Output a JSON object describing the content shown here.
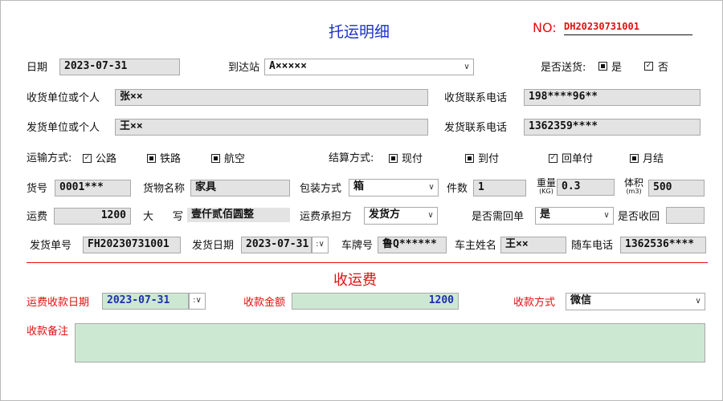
{
  "header": {
    "title": "托运明细",
    "no_label": "NO:",
    "no_value": "DH20230731001"
  },
  "row1": {
    "date_label": "日期",
    "date_value": "2023-07-31",
    "station_label": "到达站",
    "station_value": "A×××××",
    "delivery_label": "是否送货:",
    "delivery_yes": "是",
    "delivery_no": "否"
  },
  "row2": {
    "receiver_label": "收货单位或个人",
    "receiver_value": "张××",
    "receiver_phone_label": "收货联系电话",
    "receiver_phone_value": "198****96**"
  },
  "row3": {
    "sender_label": "发货单位或个人",
    "sender_value": "王××",
    "sender_phone_label": "发货联系电话",
    "sender_phone_value": "1362359****"
  },
  "row4": {
    "transport_label": "运输方式:",
    "transport_road": "公路",
    "transport_rail": "铁路",
    "transport_air": "航空",
    "settle_label": "结算方式:",
    "settle_cash": "现付",
    "settle_cod": "到付",
    "settle_receipt": "回单付",
    "settle_monthly": "月结"
  },
  "row5": {
    "goods_no_label": "货号",
    "goods_no_value": "0001***",
    "goods_name_label": "货物名称",
    "goods_name_value": "家具",
    "pack_label": "包装方式",
    "pack_value": "箱",
    "qty_label": "件数",
    "qty_value": "1",
    "weight_label": "重量",
    "weight_unit": "(KG)",
    "weight_value": "0.3",
    "volume_label": "体积",
    "volume_unit": "(m3)",
    "volume_value": "500"
  },
  "row6": {
    "freight_label": "运费",
    "freight_value": "1200",
    "capital_label_a": "大",
    "capital_label_b": "写",
    "capital_value": "壹仟贰佰圆整",
    "payer_label": "运费承担方",
    "payer_value": "发货方",
    "receipt_label": "是否需回单",
    "receipt_value": "是",
    "returned_label": "是否收回",
    "returned_value": ""
  },
  "row7": {
    "ship_no_label": "发货单号",
    "ship_no_value": "FH20230731001",
    "ship_date_label": "发货日期",
    "ship_date_value": "2023-07-31",
    "plate_label": "车牌号",
    "plate_value": "鲁Q******",
    "owner_label": "车主姓名",
    "owner_value": "王××",
    "driver_phone_label": "随车电话",
    "driver_phone_value": "1362536****"
  },
  "collect": {
    "section_title": "收运费",
    "date_label": "运费收款日期",
    "date_value": "2023-07-31",
    "amount_label": "收款金额",
    "amount_value": "1200",
    "method_label": "收款方式",
    "method_value": "微信",
    "note_label": "收款备注",
    "note_value": ""
  },
  "colors": {
    "title_blue": "#1a2fc9",
    "accent_red": "#e01010",
    "field_gray": "#e3e3e3",
    "field_green": "#cde8d2"
  }
}
